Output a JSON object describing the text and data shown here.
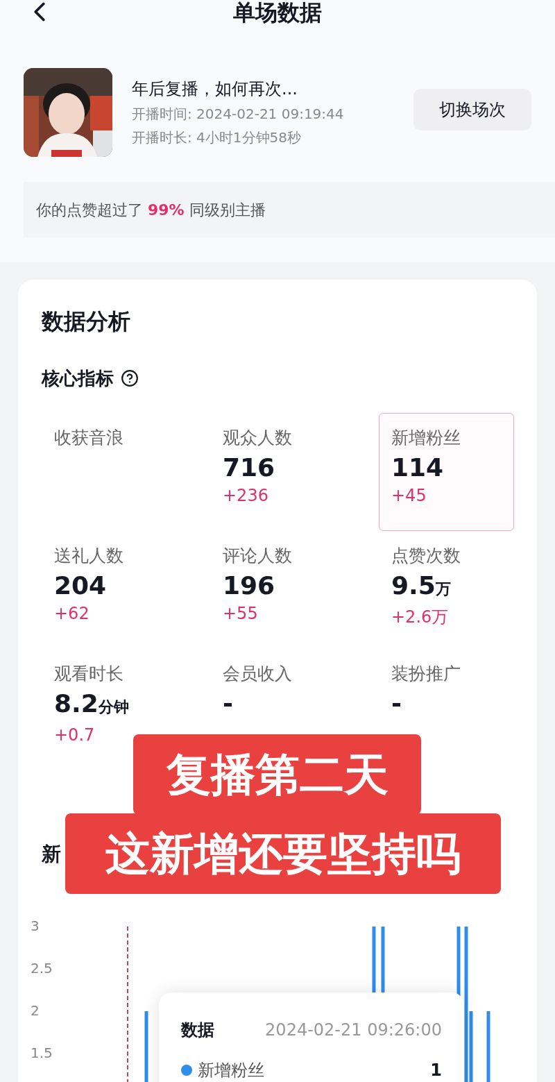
{
  "header": {
    "title": "单场数据"
  },
  "session": {
    "title": "年后复播，如何再次...",
    "start_label": "开播时间:",
    "start_time": "2024-02-21 09:19:44",
    "duration_label": "开播时长:",
    "duration": "4小时1分钟58秒",
    "switch_button": "切换场次"
  },
  "banner": {
    "text": "你的点赞超过了 **99%** 同级别主播"
  },
  "analysis": {
    "title": "数据分析",
    "section": "核心指标",
    "metrics": [
      {
        "label": "收获音浪",
        "selected": false
      },
      {
        "label": "观众人数",
        "value": "716",
        "delta": "+236",
        "selected": false
      },
      {
        "label": "新增粉丝",
        "value": "114",
        "delta": "+45",
        "selected": true
      },
      {
        "label": "送礼人数",
        "value": "204",
        "delta": "+62",
        "selected": false
      },
      {
        "label": "评论人数",
        "value": "196",
        "delta": "+55",
        "selected": false
      },
      {
        "label": "点赞次数",
        "value": "9.5",
        "unit": "万",
        "delta": "+2.6万",
        "selected": false
      },
      {
        "label": "观看时长",
        "value": "8.2",
        "unit": "分钟",
        "delta": "+0.7",
        "selected": false
      },
      {
        "label": "会员收入",
        "value": "-",
        "selected": false
      },
      {
        "label": "装扮推广",
        "value": "-",
        "selected": false
      }
    ]
  },
  "chart": {
    "title": "新",
    "y_axis_labels": [
      "3",
      "2.5",
      "2",
      "1.5"
    ],
    "tooltip": {
      "title": "数据",
      "time": "2024-02-21 09:26:00",
      "series": "新增粉丝",
      "value": "1",
      "color": "#2f8ee8"
    }
  },
  "overlay": {
    "lines": [
      "复播第二天",
      "这新增还要坚持吗"
    ]
  }
}
